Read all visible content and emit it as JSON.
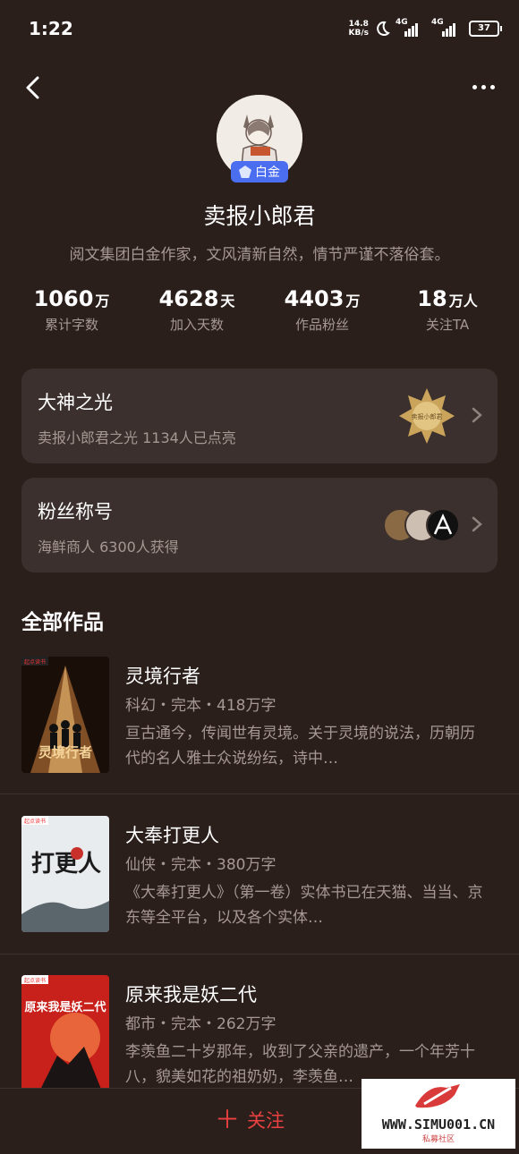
{
  "status": {
    "time": "1:22",
    "net_speed_value": "14.8",
    "net_speed_unit": "KB/s",
    "signal_1": "4G",
    "signal_2": "4G",
    "battery": "37"
  },
  "nav": {
    "back_icon": "chevron-left-icon",
    "more_icon": "more-horizontal-icon"
  },
  "author": {
    "tier": "白金",
    "name": "卖报小郎君",
    "bio": "阅文集团白金作家，文风清新自然，情节严谨不落俗套。"
  },
  "stats": [
    {
      "num": "1060",
      "unit": "万",
      "label": "累计字数"
    },
    {
      "num": "4628",
      "unit": "天",
      "label": "加入天数"
    },
    {
      "num": "4403",
      "unit": "万",
      "label": "作品粉丝"
    },
    {
      "num": "18",
      "unit": "万人",
      "label": "关注TA"
    }
  ],
  "cards": {
    "glory": {
      "title": "大神之光",
      "sub": "卖报小郎君之光 1134人已点亮",
      "badge_text": "卖报小郎君"
    },
    "fans": {
      "title": "粉丝称号",
      "sub": "海鲜商人 6300人获得"
    }
  },
  "section_title": "全部作品",
  "books": [
    {
      "title": "灵境行者",
      "meta": "科幻・完本・418万字",
      "desc": "亘古通今，传闻世有灵境。关于灵境的说法，历朝历代的名人雅士众说纷纭，诗中…",
      "cover_text": "灵境行者",
      "publisher": "起点读书"
    },
    {
      "title": "大奉打更人",
      "meta": "仙侠・完本・380万字",
      "desc": "《大奉打更人》（第一卷）实体书已在天猫、当当、京东等全平台，以及各个实体…",
      "cover_text": "打更人",
      "publisher": "起点读书"
    },
    {
      "title": "原来我是妖二代",
      "meta": "都市・完本・262万字",
      "desc": "李羡鱼二十岁那年，收到了父亲的遗产，一个年芳十八，貌美如花的祖奶奶，李羡鱼…",
      "cover_text": "原来我是妖二代",
      "publisher": "起点读书"
    }
  ],
  "bottom": {
    "follow": "关注"
  },
  "watermark": {
    "text": "WWW.SIMU001.CN",
    "sub": "私募社区"
  }
}
